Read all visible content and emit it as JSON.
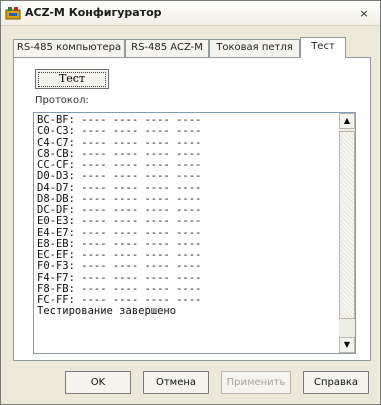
{
  "window": {
    "title": "ACZ-M Конфигуратор",
    "close_glyph": "×"
  },
  "tabs": [
    {
      "label": "RS-485 компьютера"
    },
    {
      "label": "RS-485 ACZ-M"
    },
    {
      "label": "Токовая петля"
    },
    {
      "label": "Тест"
    }
  ],
  "test_tab": {
    "test_button": "Тест",
    "protocol_label": "Протокол:",
    "log_lines": [
      "BC-BF: ---- ---- ---- ----",
      "C0-C3: ---- ---- ---- ----",
      "C4-C7: ---- ---- ---- ----",
      "C8-CB: ---- ---- ---- ----",
      "CC-CF: ---- ---- ---- ----",
      "D0-D3: ---- ---- ---- ----",
      "D4-D7: ---- ---- ---- ----",
      "D8-DB: ---- ---- ---- ----",
      "DC-DF: ---- ---- ---- ----",
      "E0-E3: ---- ---- ---- ----",
      "E4-E7: ---- ---- ---- ----",
      "E8-EB: ---- ---- ---- ----",
      "EC-EF: ---- ---- ---- ----",
      "F0-F3: ---- ---- ---- ----",
      "F4-F7: ---- ---- ---- ----",
      "F8-FB: ---- ---- ---- ----",
      "FC-FF: ---- ---- ---- ----",
      "Тестирование завершено"
    ],
    "scroll_up_glyph": "▲",
    "scroll_down_glyph": "▼"
  },
  "footer": {
    "ok_label": "OK",
    "cancel_label": "Отмена",
    "apply_label": "Применить",
    "help_label": "Справка"
  },
  "icons": {
    "app": "app-icon",
    "close": "close-icon",
    "scroll_up": "arrow-up-icon",
    "scroll_down": "arrow-down-icon"
  },
  "colors": {
    "face": "#ece9d8",
    "panel": "#ffffff",
    "log_border": "#7f9db9",
    "disabled_text": "#a9a79c"
  }
}
